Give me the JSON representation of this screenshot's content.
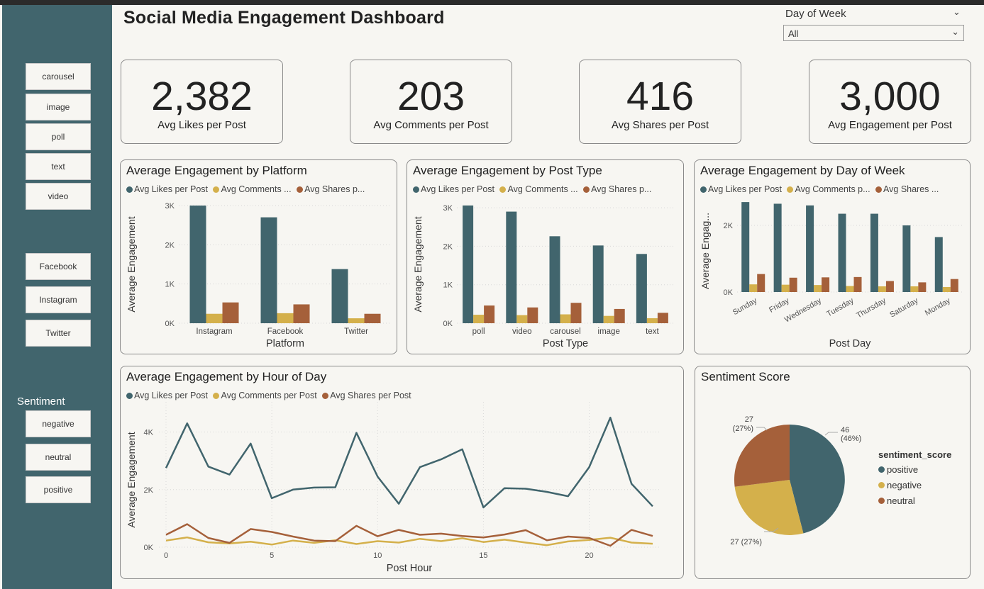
{
  "header": {
    "title": "Social Media Engagement Dashboard"
  },
  "day_filter": {
    "label": "Day of Week",
    "value": "All"
  },
  "sidebar": {
    "post_types": [
      "carousel",
      "image",
      "poll",
      "text",
      "video"
    ],
    "platforms": [
      "Facebook",
      "Instagram",
      "Twitter"
    ],
    "sentiment_label": "Sentiment",
    "sentiments": [
      "negative",
      "neutral",
      "positive"
    ]
  },
  "kpis": [
    {
      "value": "2,382",
      "label": "Avg Likes per Post"
    },
    {
      "value": "203",
      "label": "Avg Comments per Post"
    },
    {
      "value": "416",
      "label": "Avg Shares per Post"
    },
    {
      "value": "3,000",
      "label": "Avg Engagement per Post"
    }
  ],
  "colors": {
    "likes": "#41656d",
    "comments": "#d4b04b",
    "shares": "#a5603a"
  },
  "panels": {
    "platform": {
      "title": "Average Engagement by Platform",
      "legend": [
        "Avg Likes per Post",
        "Avg Comments ...",
        "Avg Shares p..."
      ]
    },
    "post_type": {
      "title": "Average Engagement by Post Type",
      "legend": [
        "Avg Likes per Post",
        "Avg Comments ...",
        "Avg Shares p..."
      ]
    },
    "day": {
      "title": "Average Engagement by Day of Week",
      "legend": [
        "Avg Likes per Post",
        "Avg Comments p...",
        "Avg Shares ..."
      ]
    },
    "hour": {
      "title": "Average Engagement by Hour of Day",
      "legend": [
        "Avg Likes per Post",
        "Avg Comments per Post",
        "Avg Shares per Post"
      ]
    },
    "sentiment": {
      "title": "Sentiment Score",
      "legend_title": "sentiment_score"
    }
  },
  "chart_data": [
    {
      "id": "platform",
      "type": "bar",
      "title": "Average Engagement by Platform",
      "xlabel": "Platform",
      "ylabel": "Average Engagement",
      "categories": [
        "Instagram",
        "Facebook",
        "Twitter"
      ],
      "ylim": [
        0,
        3000
      ],
      "yticks": [
        0,
        1000,
        2000,
        3000
      ],
      "ytick_labels": [
        "0K",
        "1K",
        "2K",
        "3K"
      ],
      "series": [
        {
          "name": "Avg Likes per Post",
          "values": [
            3000,
            2700,
            1380
          ]
        },
        {
          "name": "Avg Comments per Post",
          "values": [
            240,
            255,
            125
          ]
        },
        {
          "name": "Avg Shares per Post",
          "values": [
            530,
            480,
            240
          ]
        }
      ]
    },
    {
      "id": "post_type",
      "type": "bar",
      "title": "Average Engagement by Post Type",
      "xlabel": "Post Type",
      "ylabel": "Average Engagement",
      "categories": [
        "poll",
        "video",
        "carousel",
        "image",
        "text"
      ],
      "ylim": [
        0,
        3500
      ],
      "yticks": [
        0,
        1000,
        2000,
        3000
      ],
      "ytick_labels": [
        "0K",
        "1K",
        "2K",
        "3K"
      ],
      "series": [
        {
          "name": "Avg Likes per Post",
          "values": [
            3060,
            2900,
            2260,
            2020,
            1800
          ]
        },
        {
          "name": "Avg Comments per Post",
          "values": [
            220,
            210,
            230,
            190,
            130
          ]
        },
        {
          "name": "Avg Shares per Post",
          "values": [
            460,
            410,
            530,
            370,
            270
          ]
        }
      ]
    },
    {
      "id": "day",
      "type": "bar",
      "title": "Average Engagement by Day of Week",
      "xlabel": "Post Day",
      "ylabel": "Average Engag...",
      "categories": [
        "Sunday",
        "Friday",
        "Wednesday",
        "Tuesday",
        "Thursday",
        "Saturday",
        "Monday"
      ],
      "ylim": [
        0,
        3000
      ],
      "yticks": [
        0,
        2000
      ],
      "ytick_labels": [
        "0K",
        "2K"
      ],
      "series": [
        {
          "name": "Avg Likes per Post",
          "values": [
            2700,
            2650,
            2600,
            2350,
            2350,
            2000,
            1650
          ]
        },
        {
          "name": "Avg Comments per Post",
          "values": [
            230,
            220,
            210,
            180,
            170,
            170,
            150
          ]
        },
        {
          "name": "Avg Shares per Post",
          "values": [
            540,
            430,
            440,
            450,
            330,
            290,
            390
          ]
        }
      ]
    },
    {
      "id": "hour",
      "type": "line",
      "title": "Average Engagement by Hour of Day",
      "xlabel": "Post Hour",
      "ylabel": "Average Engagement",
      "xlim": [
        0,
        23
      ],
      "xticks": [
        0,
        5,
        10,
        15,
        20
      ],
      "ylim": [
        0,
        4800
      ],
      "yticks": [
        0,
        2000,
        4000
      ],
      "ytick_labels": [
        "0K",
        "2K",
        "4K"
      ],
      "x": [
        0,
        1,
        2,
        3,
        4,
        5,
        6,
        7,
        8,
        9,
        10,
        11,
        12,
        13,
        14,
        15,
        16,
        17,
        18,
        19,
        20,
        21,
        22,
        23
      ],
      "series": [
        {
          "name": "Avg Likes per Post",
          "values": [
            2750,
            4300,
            2800,
            2520,
            3600,
            1700,
            2000,
            2070,
            2080,
            3970,
            2450,
            1510,
            2780,
            3050,
            3400,
            1380,
            2050,
            2030,
            1920,
            1770,
            2780,
            4500,
            2200,
            1420
          ]
        },
        {
          "name": "Avg Comments per Post",
          "values": [
            230,
            340,
            170,
            130,
            190,
            90,
            230,
            150,
            240,
            110,
            210,
            160,
            290,
            210,
            310,
            180,
            260,
            160,
            70,
            200,
            250,
            330,
            160,
            120
          ]
        },
        {
          "name": "Avg Shares per Post",
          "values": [
            430,
            800,
            320,
            150,
            630,
            530,
            370,
            230,
            210,
            740,
            380,
            600,
            430,
            470,
            390,
            340,
            440,
            590,
            240,
            370,
            320,
            50,
            600,
            390
          ]
        }
      ]
    },
    {
      "id": "sentiment",
      "type": "pie",
      "title": "Sentiment Score",
      "labels": [
        "positive",
        "negative",
        "neutral"
      ],
      "values": [
        46,
        27,
        27
      ],
      "percent_labels": [
        "46",
        "(46%)",
        "27 (27%)",
        "27",
        "(27%)"
      ],
      "legend_title": "sentiment_score",
      "legend": "right"
    }
  ]
}
